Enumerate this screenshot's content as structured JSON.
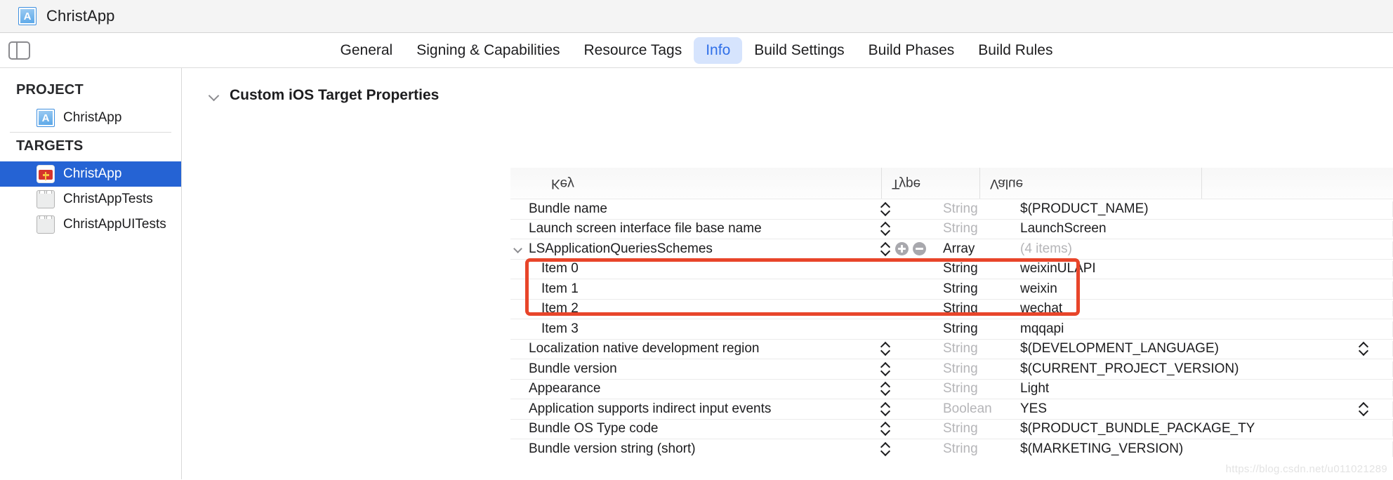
{
  "titlebar": {
    "title": "ChristApp",
    "icon": "project-document-icon"
  },
  "tabbar": {
    "toggle_icon": "sidebar-toggle-icon",
    "tabs": [
      {
        "label": "General",
        "active": false
      },
      {
        "label": "Signing & Capabilities",
        "active": false
      },
      {
        "label": "Resource Tags",
        "active": false
      },
      {
        "label": "Info",
        "active": true
      },
      {
        "label": "Build Settings",
        "active": false
      },
      {
        "label": "Build Phases",
        "active": false
      },
      {
        "label": "Build Rules",
        "active": false
      }
    ],
    "active_tab": "Info",
    "active_tab_bg": "#d6e4fd",
    "active_tab_fg": "#2f6fe8"
  },
  "sidebar": {
    "project_header": "PROJECT",
    "targets_header": "TARGETS",
    "project_items": [
      {
        "label": "ChristApp",
        "icon": "project-document-icon",
        "selected": false
      }
    ],
    "target_items": [
      {
        "label": "ChristApp",
        "icon": "app-bible-icon",
        "selected": true
      },
      {
        "label": "ChristAppTests",
        "icon": "test-bundle-icon",
        "selected": false
      },
      {
        "label": "ChristAppUITests",
        "icon": "test-bundle-icon",
        "selected": false
      }
    ],
    "selection_color": "#2563d4"
  },
  "main": {
    "section_title": "Custom iOS Target Properties",
    "section_chevron": "chevron-down-icon",
    "columns": [
      "Key",
      "Type",
      "Value"
    ],
    "header_flipped": true,
    "rows": [
      {
        "key": "Bundle name",
        "type": "String",
        "type_dim": true,
        "value": "$(PRODUCT_NAME)",
        "value_dim": false,
        "stepper": true,
        "child": false,
        "disclosure": "",
        "plusminus": false,
        "value_stepper": false
      },
      {
        "key": "Launch screen interface file base name",
        "type": "String",
        "type_dim": true,
        "value": "LaunchScreen",
        "value_dim": false,
        "stepper": true,
        "child": false,
        "disclosure": "",
        "plusminus": false,
        "value_stepper": false
      },
      {
        "key": "LSApplicationQueriesSchemes",
        "type": "Array",
        "type_dim": false,
        "value": "(4 items)",
        "value_dim": true,
        "stepper": true,
        "child": false,
        "disclosure": "chevron-down-icon",
        "plusminus": true,
        "value_stepper": false
      },
      {
        "key": "Item 0",
        "type": "String",
        "type_dim": false,
        "value": "weixinULAPI",
        "value_dim": false,
        "stepper": false,
        "child": true,
        "disclosure": "",
        "plusminus": false,
        "value_stepper": false
      },
      {
        "key": "Item 1",
        "type": "String",
        "type_dim": false,
        "value": "weixin",
        "value_dim": false,
        "stepper": false,
        "child": true,
        "disclosure": "",
        "plusminus": false,
        "value_stepper": false
      },
      {
        "key": "Item 2",
        "type": "String",
        "type_dim": false,
        "value": "wechat",
        "value_dim": false,
        "stepper": false,
        "child": true,
        "disclosure": "",
        "plusminus": false,
        "value_stepper": false
      },
      {
        "key": "Item 3",
        "type": "String",
        "type_dim": false,
        "value": "mqqapi",
        "value_dim": false,
        "stepper": false,
        "child": true,
        "disclosure": "",
        "plusminus": false,
        "value_stepper": false
      },
      {
        "key": "Localization native development region",
        "type": "String",
        "type_dim": true,
        "value": "$(DEVELOPMENT_LANGUAGE)",
        "value_dim": false,
        "stepper": true,
        "child": false,
        "disclosure": "",
        "plusminus": false,
        "value_stepper": true
      },
      {
        "key": "Bundle version",
        "type": "String",
        "type_dim": true,
        "value": "$(CURRENT_PROJECT_VERSION)",
        "value_dim": false,
        "stepper": true,
        "child": false,
        "disclosure": "",
        "plusminus": false,
        "value_stepper": false
      },
      {
        "key": "Appearance",
        "type": "String",
        "type_dim": true,
        "value": "Light",
        "value_dim": false,
        "stepper": true,
        "child": false,
        "disclosure": "",
        "plusminus": false,
        "value_stepper": false
      },
      {
        "key": "Application supports indirect input events",
        "type": "Boolean",
        "type_dim": true,
        "value": "YES",
        "value_dim": false,
        "stepper": true,
        "child": false,
        "disclosure": "",
        "plusminus": false,
        "value_stepper": true
      },
      {
        "key": "Bundle OS Type code",
        "type": "String",
        "type_dim": true,
        "value": "$(PRODUCT_BUNDLE_PACKAGE_TY",
        "value_dim": false,
        "stepper": true,
        "child": false,
        "disclosure": "",
        "plusminus": false,
        "value_stepper": false
      },
      {
        "key": "Bundle version string (short)",
        "type": "String",
        "type_dim": true,
        "value": "$(MARKETING_VERSION)",
        "value_dim": false,
        "stepper": true,
        "child": false,
        "disclosure": "",
        "plusminus": false,
        "value_stepper": false
      }
    ],
    "annotation": {
      "color": "#e8452a",
      "covers": [
        "Item 0",
        "Item 1",
        "Item 2"
      ]
    },
    "watermark": "https://blog.csdn.net/u011021289"
  }
}
